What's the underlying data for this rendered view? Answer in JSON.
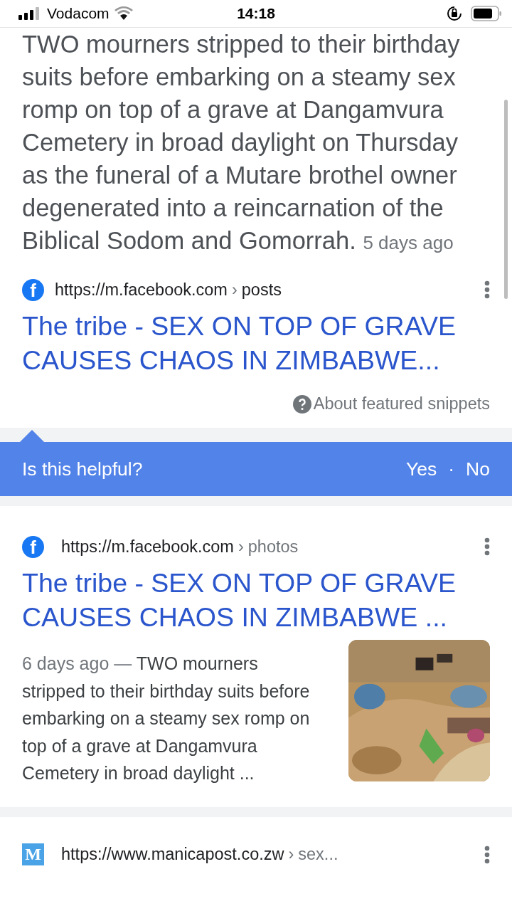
{
  "status_bar": {
    "carrier": "Vodacom",
    "time": "14:18"
  },
  "featured_snippet": {
    "text": "TWO mourners stripped to their birthday suits before embarking on a steamy sex romp on top of a grave at Dangamvura Cemetery in broad daylight on Thursday as the funeral of a Mutare brothel owner degenerated into a reincarnation of the Biblical Sodom and Gomorrah.",
    "age": "5 days ago",
    "source": {
      "favicon": {
        "kind": "facebook",
        "letter": "f"
      },
      "url": "https://m.facebook.com",
      "separator": "›",
      "path": "posts"
    },
    "title": "The tribe - SEX ON TOP OF GRAVE CAUSES CHAOS IN ZIMBABWE...",
    "about_label": "About featured snippets"
  },
  "feedback": {
    "question": "Is this helpful?",
    "yes": "Yes",
    "separator": "·",
    "no": "No"
  },
  "results": [
    {
      "source": {
        "favicon": {
          "kind": "facebook",
          "letter": "f"
        },
        "url": "https://m.facebook.com",
        "separator": "›",
        "path": "photos"
      },
      "title": "The tribe - SEX ON TOP OF GRAVE CAUSES CHAOS IN ZIMBABWE ...",
      "age": "6 days ago",
      "dash": "—",
      "snippet": "TWO mourners stripped to their birthday suits before embarking on a steamy sex romp on top of a grave at Dangamvura Cemetery in broad daylight ..."
    },
    {
      "source": {
        "favicon": {
          "kind": "tile",
          "letter": "M"
        },
        "url": "https://www.manicapost.co.zw",
        "separator": "›",
        "path": "sex..."
      }
    }
  ]
}
